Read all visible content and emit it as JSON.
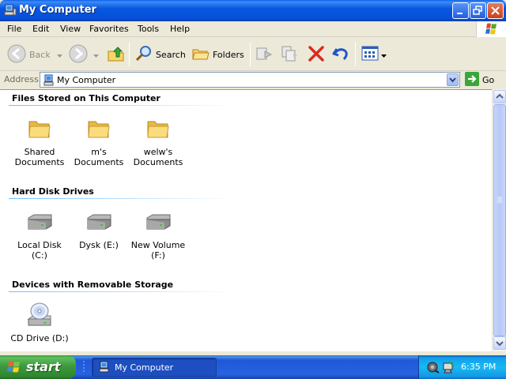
{
  "window": {
    "title": "My Computer",
    "controls": [
      "minimize",
      "restore",
      "close"
    ]
  },
  "menu": {
    "items": [
      "File",
      "Edit",
      "View",
      "Favorites",
      "Tools",
      "Help"
    ]
  },
  "toolbar": {
    "back_label": "Back",
    "search_label": "Search",
    "folders_label": "Folders"
  },
  "address": {
    "label": "Address",
    "value": "My Computer",
    "go_label": "Go"
  },
  "groups": [
    {
      "title": "Files Stored on This Computer",
      "items": [
        {
          "label": "Shared Documents",
          "icon": "folder-icon"
        },
        {
          "label": "m's Documents",
          "icon": "folder-icon"
        },
        {
          "label": "welw's Documents",
          "icon": "folder-icon"
        }
      ]
    },
    {
      "title": "Hard Disk Drives",
      "items": [
        {
          "label": "Local Disk (C:)",
          "icon": "hard-disk-icon"
        },
        {
          "label": "Dysk (E:)",
          "icon": "hard-disk-icon"
        },
        {
          "label": "New Volume (F:)",
          "icon": "hard-disk-icon"
        }
      ]
    },
    {
      "title": "Devices with Removable Storage",
      "items": [
        {
          "label": "CD Drive (D:)",
          "icon": "cd-drive-icon"
        }
      ]
    }
  ],
  "taskbar": {
    "start_label": "start",
    "task_label": "My Computer",
    "clock": "6:35 PM"
  },
  "colors": {
    "titlebar": "#0857e0",
    "taskbar": "#2663e0",
    "start": "#3d9a3d",
    "group_rule": "#70bfff"
  }
}
